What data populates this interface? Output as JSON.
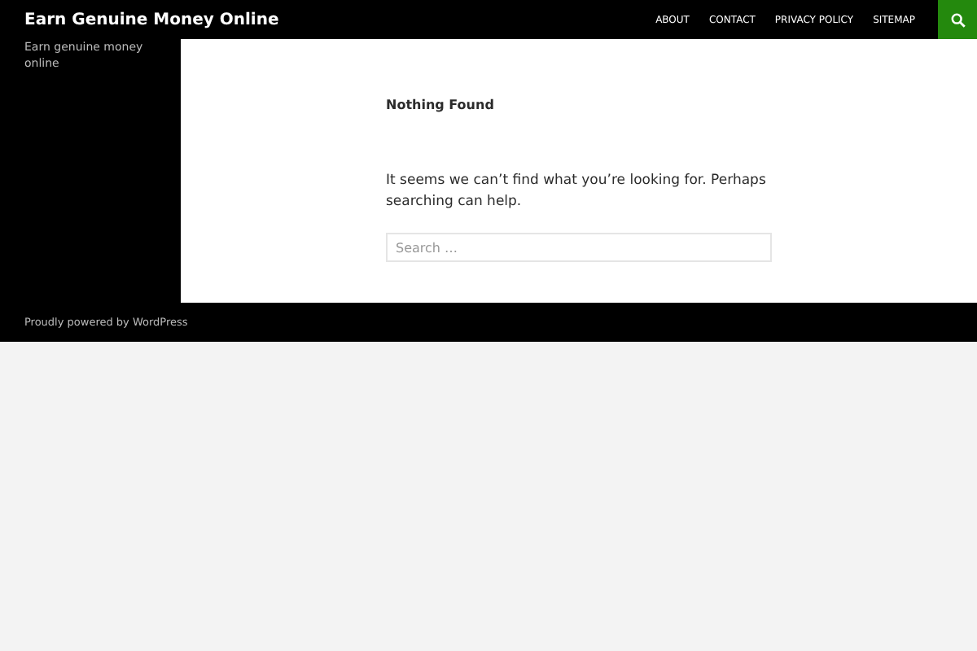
{
  "site": {
    "title": "Earn Genuine Money Online",
    "tagline": "Earn genuine money online"
  },
  "nav": {
    "items": [
      {
        "label": "ABOUT"
      },
      {
        "label": "CONTACT"
      },
      {
        "label": "PRIVACY POLICY"
      },
      {
        "label": "SITEMAP"
      }
    ]
  },
  "content": {
    "title": "Nothing Found",
    "message": "It seems we can’t find what you’re looking for. Perhaps searching can help.",
    "search": {
      "placeholder": "Search …"
    }
  },
  "footer": {
    "credit": "Proudly powered by WordPress"
  }
}
